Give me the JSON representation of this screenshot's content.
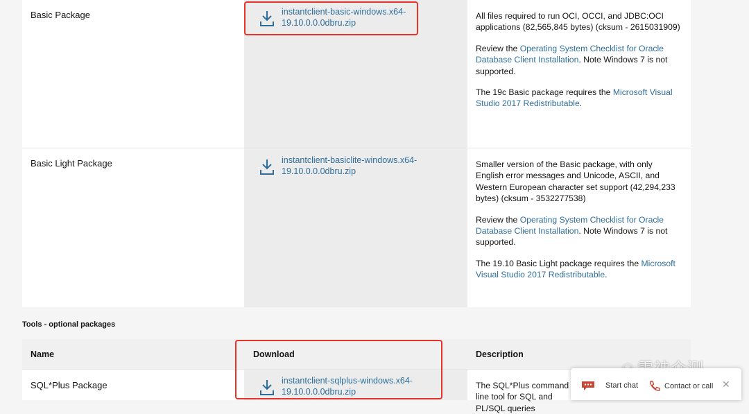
{
  "rows": [
    {
      "name": "Basic Package",
      "file_line1": "instantclient-basic-windows.x64-",
      "file_line2": "19.10.0.0.0dbru.zip",
      "desc1": "All files required to run OCI, OCCI, and JDBC:OCI applications (82,565,845 bytes) (cksum - 2615031909)",
      "desc2_pre": "Review the ",
      "desc2_link": "Operating System Checklist for Oracle Database Client Installation",
      "desc2_post": ". Note Windows 7 is not supported.",
      "desc3_pre": "The 19c Basic package requires the ",
      "desc3_link": "Microsoft Visual Studio 2017 Redistributable",
      "desc3_post": "."
    },
    {
      "name": "Basic Light Package",
      "file_line1": "instantclient-basiclite-windows.x64-",
      "file_line2": "19.10.0.0.0dbru.zip",
      "desc1": "Smaller version of the Basic package, with only English error messages and Unicode, ASCII, and Western European character set support (42,294,233 bytes) (cksum - 3532277538)",
      "desc2_pre": "Review the ",
      "desc2_link": "Operating System Checklist for Oracle Database Client Installation",
      "desc2_post": ". Note Windows 7 is not supported.",
      "desc3_pre": "The 19.10 Basic Light package requires the ",
      "desc3_link": "Microsoft Visual Studio 2017 Redistributable",
      "desc3_post": "."
    }
  ],
  "tools": {
    "title": "Tools - optional packages",
    "headers": {
      "name": "Name",
      "download": "Download",
      "description": "Description"
    },
    "row": {
      "name": "SQL*Plus Package",
      "file_line1": "instantclient-sqlplus-windows.x64-",
      "file_line2": "19.10.0.0.0dbru.zip",
      "desc": "The SQL*Plus command line tool for SQL and PL/SQL queries"
    }
  },
  "chat": {
    "start_chat": "Start chat",
    "contact": "Contact or call"
  },
  "watermark": "雷神众测",
  "colors": {
    "link": "#2f6e9a",
    "highlight": "#e8322c",
    "chat_accent": "#c74634"
  }
}
